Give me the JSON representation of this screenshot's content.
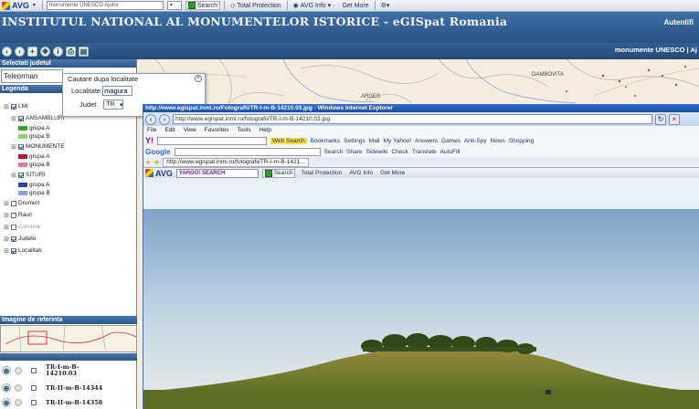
{
  "avg_toolbar": {
    "brand": "AVG",
    "search_text": "monumente UNESCO Ajutor",
    "search_label": "Search",
    "protection_label": "Total Protection",
    "info_label": "AVG Info",
    "getmore_label": "Get More"
  },
  "banner": {
    "title": "INSTITUTUL NATIONAL AL MONUMENTELOR ISTORICE - eGISpat Romania",
    "auth": "Autentifi"
  },
  "iconrow": {
    "right_text": "monumente UNESCO | Aj"
  },
  "sidebar": {
    "select_county_header": "Selectati judetul",
    "county_value": "Teleorman",
    "legend_header": "Legenda",
    "legend": [
      {
        "label": "LMI",
        "checked": true,
        "level": 0
      },
      {
        "label": "ANSAMBLURI",
        "checked": true,
        "level": 1
      },
      {
        "label": "grupa A",
        "swatch": "#3aa12e",
        "level": 2
      },
      {
        "label": "grupa B",
        "swatch": "#8fd46e",
        "level": 2
      },
      {
        "label": "MONUMENTE",
        "checked": true,
        "level": 1
      },
      {
        "label": "grupa A",
        "swatch": "#b1162b",
        "level": 2
      },
      {
        "label": "grupa B",
        "swatch": "#e07aa0",
        "level": 2
      },
      {
        "label": "SITURI",
        "checked": true,
        "level": 1
      },
      {
        "label": "grupa A",
        "swatch": "#2c3ea8",
        "level": 2
      },
      {
        "label": "grupa B",
        "swatch": "#8aa0e6",
        "level": 2
      },
      {
        "label": "Drumuri",
        "checked": false,
        "level": 0
      },
      {
        "label": "Rauri",
        "checked": false,
        "level": 0
      },
      {
        "label": "Comune",
        "checked": false,
        "level": 0,
        "disabled": true
      },
      {
        "label": "Judete",
        "checked": true,
        "level": 0
      },
      {
        "label": "Localitati",
        "checked": true,
        "level": 0
      }
    ],
    "reference_header": "Imagine de referinta",
    "results": [
      {
        "code": "TR-I-m-B-14210.03"
      },
      {
        "code": "TR-II-m-B-14344"
      },
      {
        "code": "TR-II-m-B-14358"
      }
    ]
  },
  "map": {
    "labels": [
      "DAMBOVITA",
      "ARGES"
    ]
  },
  "popup": {
    "title": "Cautare dupa localitate",
    "localitate_label": "Localitate",
    "localitate_value": "magura",
    "judet_label": "Judet",
    "judet_value": "TR"
  },
  "ie": {
    "title": "http://www.egispat.inmi.ro/Fotografii/TR-I-m-B-14210.03.jpg - Windows Internet Explorer",
    "address": "http://www.egispat.inmi.ro/fotografii/TR-I-m-B-14210.03.jpg",
    "menu": [
      "File",
      "Edit",
      "View",
      "Favorites",
      "Tools",
      "Help"
    ],
    "toolbar": [
      "Web Search",
      "Bookmarks",
      "Settings",
      "Mail",
      "My Yahoo!",
      "Answers",
      "Games",
      "Anti-Spy",
      "News",
      "Shopping"
    ],
    "google_items": [
      "Search",
      "Share",
      "Sidewiki",
      "Check",
      "Translate",
      "AutoFill"
    ],
    "tab_title": "http://www.egispat.inmi.ro/fotografii/TR-I-m-B-1421...",
    "avg_search": "YAHOO! SEARCH"
  }
}
